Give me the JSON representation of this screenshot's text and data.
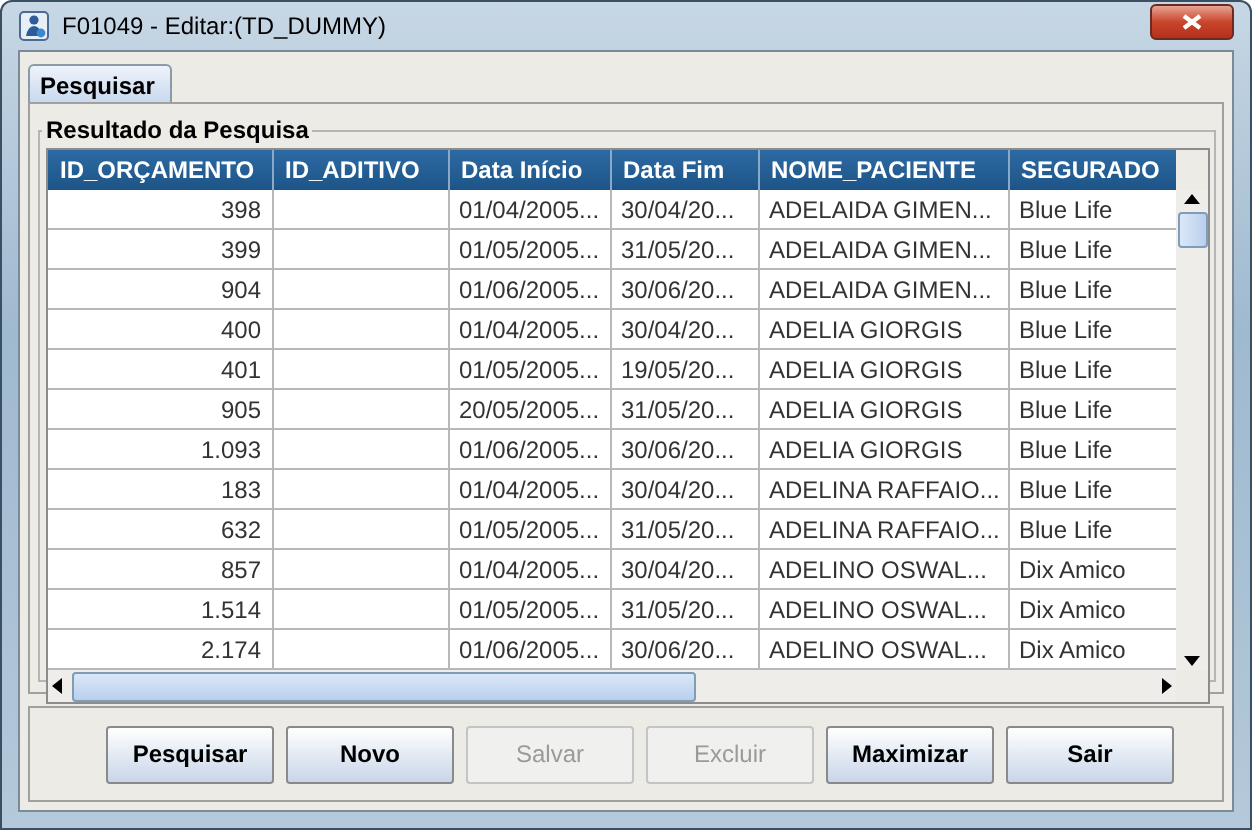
{
  "window": {
    "title": "F01049 - Editar:(TD_DUMMY)"
  },
  "tabs": [
    {
      "label": "Pesquisar",
      "selected": true
    }
  ],
  "group": {
    "title": "Resultado da Pesquisa"
  },
  "table": {
    "columns": [
      "ID_ORÇAMENTO",
      "ID_ADITIVO",
      "Data Início",
      "Data Fim",
      "NOME_PACIENTE",
      "SEGURADO"
    ],
    "rows": [
      {
        "id_orcamento": "398",
        "data_inicio": "01/04/2005...",
        "data_fim": "30/04/20...",
        "nome_paciente": "ADELAIDA GIMEN...",
        "segurador": "Blue Life"
      },
      {
        "id_orcamento": "399",
        "data_inicio": "01/05/2005...",
        "data_fim": "31/05/20...",
        "nome_paciente": "ADELAIDA GIMEN...",
        "segurador": "Blue Life"
      },
      {
        "id_orcamento": "904",
        "data_inicio": "01/06/2005...",
        "data_fim": "30/06/20...",
        "nome_paciente": "ADELAIDA GIMEN...",
        "segurador": "Blue Life"
      },
      {
        "id_orcamento": "400",
        "data_inicio": "01/04/2005...",
        "data_fim": "30/04/20...",
        "nome_paciente": "ADELIA GIORGIS",
        "segurador": "Blue Life"
      },
      {
        "id_orcamento": "401",
        "data_inicio": "01/05/2005...",
        "data_fim": "19/05/20...",
        "nome_paciente": "ADELIA GIORGIS",
        "segurador": "Blue Life"
      },
      {
        "id_orcamento": "905",
        "data_inicio": "20/05/2005...",
        "data_fim": "31/05/20...",
        "nome_paciente": "ADELIA GIORGIS",
        "segurador": "Blue Life"
      },
      {
        "id_orcamento": "1.093",
        "data_inicio": "01/06/2005...",
        "data_fim": "30/06/20...",
        "nome_paciente": "ADELIA GIORGIS",
        "segurador": "Blue Life"
      },
      {
        "id_orcamento": "183",
        "data_inicio": "01/04/2005...",
        "data_fim": "30/04/20...",
        "nome_paciente": "ADELINA RAFFAIO...",
        "segurador": "Blue Life"
      },
      {
        "id_orcamento": "632",
        "data_inicio": "01/05/2005...",
        "data_fim": "31/05/20...",
        "nome_paciente": "ADELINA RAFFAIO...",
        "segurador": "Blue Life"
      },
      {
        "id_orcamento": "857",
        "data_inicio": "01/04/2005...",
        "data_fim": "30/04/20...",
        "nome_paciente": "ADELINO OSWAL...",
        "segurador": "Dix Amico"
      },
      {
        "id_orcamento": "1.514",
        "data_inicio": "01/05/2005...",
        "data_fim": "31/05/20...",
        "nome_paciente": "ADELINO OSWAL...",
        "segurador": "Dix Amico"
      },
      {
        "id_orcamento": "2.174",
        "data_inicio": "01/06/2005...",
        "data_fim": "30/06/20...",
        "nome_paciente": "ADELINO OSWAL...",
        "segurador": "Dix Amico"
      }
    ]
  },
  "buttons": [
    {
      "label": "Pesquisar",
      "disabled": false
    },
    {
      "label": "Novo",
      "disabled": false
    },
    {
      "label": "Salvar",
      "disabled": true
    },
    {
      "label": "Excluir",
      "disabled": true
    },
    {
      "label": "Maximizar",
      "disabled": false
    },
    {
      "label": "Sair",
      "disabled": false
    }
  ]
}
